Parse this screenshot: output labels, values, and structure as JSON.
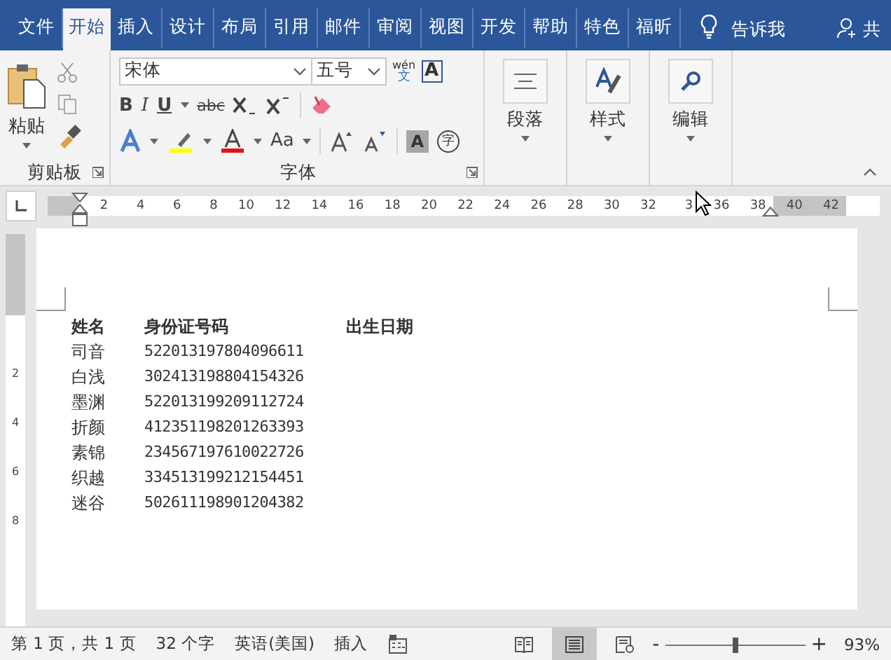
{
  "tabs": [
    {
      "label": "文件",
      "selected": false
    },
    {
      "label": "开始",
      "selected": true
    },
    {
      "label": "插入",
      "selected": false
    },
    {
      "label": "设计",
      "selected": false
    },
    {
      "label": "布局",
      "selected": false
    },
    {
      "label": "引用",
      "selected": false
    },
    {
      "label": "邮件",
      "selected": false
    },
    {
      "label": "审阅",
      "selected": false
    },
    {
      "label": "视图",
      "selected": false
    },
    {
      "label": "开发",
      "selected": false
    },
    {
      "label": "帮助",
      "selected": false
    },
    {
      "label": "特色",
      "selected": false
    },
    {
      "label": "福昕",
      "selected": false
    }
  ],
  "tell_me": "告诉我",
  "share": "共",
  "clipboard": {
    "paste": "粘贴",
    "group": "剪贴板"
  },
  "font": {
    "name": "宋体",
    "size": "五号",
    "group": "字体",
    "bold": "B",
    "italic": "I",
    "underline": "U",
    "strike": "abc",
    "change_case": "Aa",
    "phonetic_top": "wén",
    "phonetic_bottom": "文",
    "border_char": "A",
    "shade_char": "A",
    "enclose_char": "字"
  },
  "big_groups": [
    {
      "label": "段落",
      "kind": "paragraph"
    },
    {
      "label": "样式",
      "kind": "styles"
    },
    {
      "label": "编辑",
      "kind": "editing"
    }
  ],
  "ruler": {
    "ticks": [
      {
        "label": "2",
        "margin": false
      },
      {
        "label": "4",
        "margin": false
      },
      {
        "label": "6",
        "margin": false
      },
      {
        "label": "8",
        "margin": false
      },
      {
        "label": "10",
        "margin": false
      },
      {
        "label": "12",
        "margin": false
      },
      {
        "label": "14",
        "margin": false
      },
      {
        "label": "16",
        "margin": false
      },
      {
        "label": "18",
        "margin": false
      },
      {
        "label": "20",
        "margin": false
      },
      {
        "label": "22",
        "margin": false
      },
      {
        "label": "24",
        "margin": false
      },
      {
        "label": "26",
        "margin": false
      },
      {
        "label": "28",
        "margin": false
      },
      {
        "label": "30",
        "margin": false
      },
      {
        "label": "32",
        "margin": false
      },
      {
        "label": "3",
        "margin": false
      },
      {
        "label": "36",
        "margin": false
      },
      {
        "label": "38",
        "margin": false
      },
      {
        "label": "40",
        "margin": true
      },
      {
        "label": "42",
        "margin": true
      }
    ],
    "vertical_ticks": [
      "2",
      "4",
      "6",
      "8"
    ]
  },
  "table": {
    "columns": [
      "姓名",
      "身份证号码",
      "出生日期"
    ],
    "rows": [
      [
        "司音",
        "522013197804096611"
      ],
      [
        "白浅",
        "302413198804154326"
      ],
      [
        "墨渊",
        "522013199209112724"
      ],
      [
        "折颜",
        "412351198201263393"
      ],
      [
        "素锦",
        "234567197610022726"
      ],
      [
        "织越",
        "334513199212154451"
      ],
      [
        "迷谷",
        "502611198901204382"
      ]
    ]
  },
  "status_bar": {
    "page": "第 1 页，共 1 页",
    "words": "32 个字",
    "language": "英语(美国)",
    "mode": "插入",
    "views": [
      {
        "kind": "read",
        "selected": false
      },
      {
        "kind": "print",
        "selected": true
      },
      {
        "kind": "web",
        "selected": false
      }
    ],
    "zoom_minus": "-",
    "zoom_plus": "+",
    "zoom": {
      "level": 0.5
    },
    "zoom_text": "93%"
  }
}
